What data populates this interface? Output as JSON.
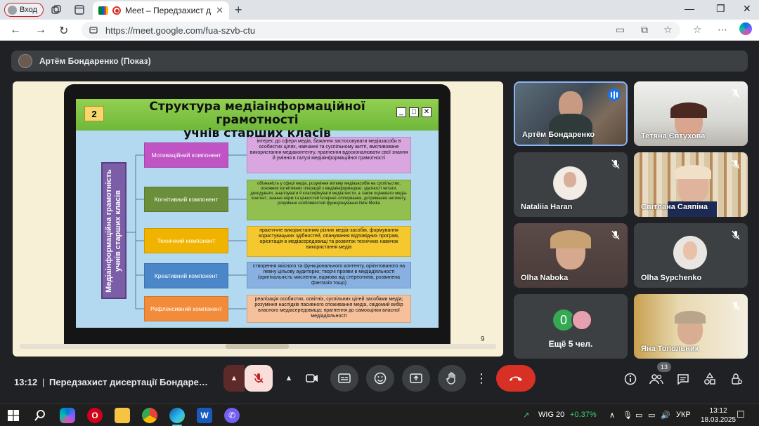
{
  "browser": {
    "profile_label": "Вход",
    "tab_title": "Meet – Передзахист дисерт",
    "url": "https://meet.google.com/fua-szvb-ctu"
  },
  "meet": {
    "presenter_label": "Артём Бондаренко (Показ)",
    "slide": {
      "number": "2",
      "title_line1": "Структура медіаінформаційної грамотності",
      "title_line2": "учнів старших класів",
      "vertical_label_line1": "Медіаінформаційна грамотність",
      "vertical_label_line2": "учнів старших класів",
      "components": [
        {
          "label": "Мотиваційний компонент",
          "color": "#c054c4",
          "desc_color": "#d9a6e0",
          "desc": "інтерес до сфери медіа, бажання застосовувати медіазасоби в особистих цілях, навчанні та суспільному житті, вмотивоване використання медіаконтенту, прагнення вдосконалювати свої знання й уміння в галузі медіаінформаційної грамотності"
        },
        {
          "label": "Когнітивний компонент",
          "color": "#6b8e3a",
          "desc_color": "#92c050",
          "desc": "обізнаність у сфері медіа, розуміння впливу медіазасобів на суспільство; основних когнітивних операцій з медіаінформацією: здатності читати, декодувати, аналізувати й класифікувати медіатексти, а також оцінювати медіа-контент; знання норм та цінностей Інтернет-спілкування, дотримання нетикету, розуміння особливостей функціонування New Media"
        },
        {
          "label": "Технічний компонент",
          "color": "#f0b400",
          "desc_color": "#f5c82e",
          "desc": "практичне використанням різних медіа-засобів, формування користувацьких здібностей, опанування відповідних програм, орієнтація в медіасередовищі та розвиток технічних навичок використання медіа"
        },
        {
          "label": "Креативний компонент",
          "color": "#4a86c8",
          "desc_color": "#88b0e0",
          "desc": "створення якісного та функціонального контенту, орієнтованого на певну цільову аудиторію; творчі прояви в медіадіяльності (оригінальність мислення, відмова від стереотипів, розвинена фантазія тощо)"
        },
        {
          "label": "Рефлексивний компонент",
          "color": "#f28c3a",
          "desc_color": "#f5c09a",
          "desc": "реалізація особистих, освітніх, суспільних цілей засобами медіа; розуміння наслідків пасивного споживання медіа, свідомий вибір власного медіасередовища; прагнення до самооцінки власної медіадіяльності"
        }
      ],
      "page_number": "9"
    },
    "participants": [
      {
        "name": "Артём Бондаренко",
        "speaking": true
      },
      {
        "name": "Тетяна Євтухова",
        "muted": true
      },
      {
        "name": "Nataliia Haran",
        "muted": true
      },
      {
        "name": "Світлана Саяпіна",
        "muted": true
      },
      {
        "name": "Olha Naboka",
        "muted": true
      },
      {
        "name": "Olha Sypchenko",
        "muted": true
      },
      {
        "name": "Ещё 5 чел.",
        "count_digit": "0"
      },
      {
        "name": "Яна Топольник",
        "muted": true
      }
    ],
    "bottom": {
      "time": "13:12",
      "meeting_title": "Передзахист дисертації Бондаренко",
      "people_count": "13"
    }
  },
  "taskbar": {
    "ticker_name": "WIG 20",
    "ticker_change": "+0.37%",
    "language": "УКР",
    "time": "13:12",
    "date": "18.03.2025"
  }
}
